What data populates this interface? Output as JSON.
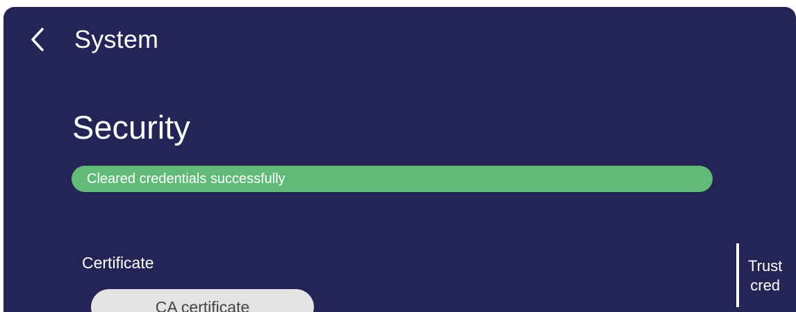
{
  "header": {
    "back_icon": "chevron-left-icon",
    "title": "System"
  },
  "page": {
    "title": "Security"
  },
  "toast": {
    "message": "Cleared credentials successfully",
    "color": "#62ba78"
  },
  "certificate": {
    "label": "Certificate",
    "ca_button_label": "CA certificate"
  },
  "side": {
    "line1": "Trust",
    "line2": "cred"
  },
  "colors": {
    "background": "#252457",
    "button": "#e3e3e3"
  }
}
